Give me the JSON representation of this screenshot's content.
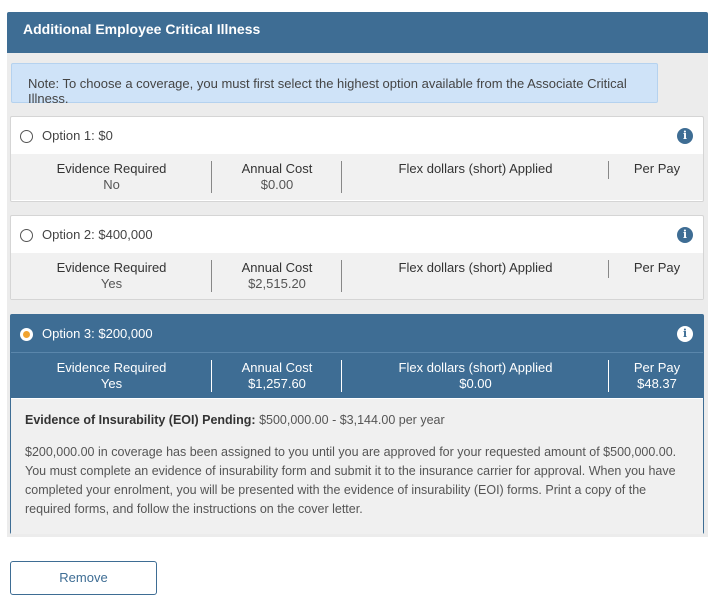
{
  "header": {
    "title": "Additional Employee Critical Illness"
  },
  "note": "Note: To choose a coverage, you must first select the highest option available from the Associate Critical Illness.",
  "columns": {
    "evidence": "Evidence Required",
    "annual": "Annual Cost",
    "flex": "Flex dollars (short) Applied",
    "perpay": "Per Pay"
  },
  "options": [
    {
      "title": "Option 1: $0",
      "selected": false,
      "evidence": "No",
      "annual": "$0.00",
      "flex": "",
      "perpay": ""
    },
    {
      "title": "Option 2: $400,000",
      "selected": false,
      "evidence": "Yes",
      "annual": "$2,515.20",
      "flex": "",
      "perpay": ""
    },
    {
      "title": "Option 3: $200,000",
      "selected": true,
      "evidence": "Yes",
      "annual": "$1,257.60",
      "flex": "$0.00",
      "perpay": "$48.37"
    }
  ],
  "eoi": {
    "label": "Evidence of Insurability (EOI) Pending:",
    "value": "$500,000.00 - $3,144.00 per year",
    "message": "$200,000.00 in coverage has been assigned to you until you are approved for your requested amount of $500,000.00. You must complete an evidence of insurability form and submit it to the insurance carrier for approval. When you have completed your enrolment, you will be presented with the evidence of insurability (EOI) forms. Print a copy of the required forms, and follow the instructions on the cover letter."
  },
  "info_icon_glyph": "i",
  "icons": {
    "info": "info-icon",
    "radio": "radio-button"
  },
  "colors": {
    "header": "#3e6d94",
    "note_bg": "#cfe3f8",
    "selected_radio": "#f0a330"
  },
  "remove_label": "Remove"
}
